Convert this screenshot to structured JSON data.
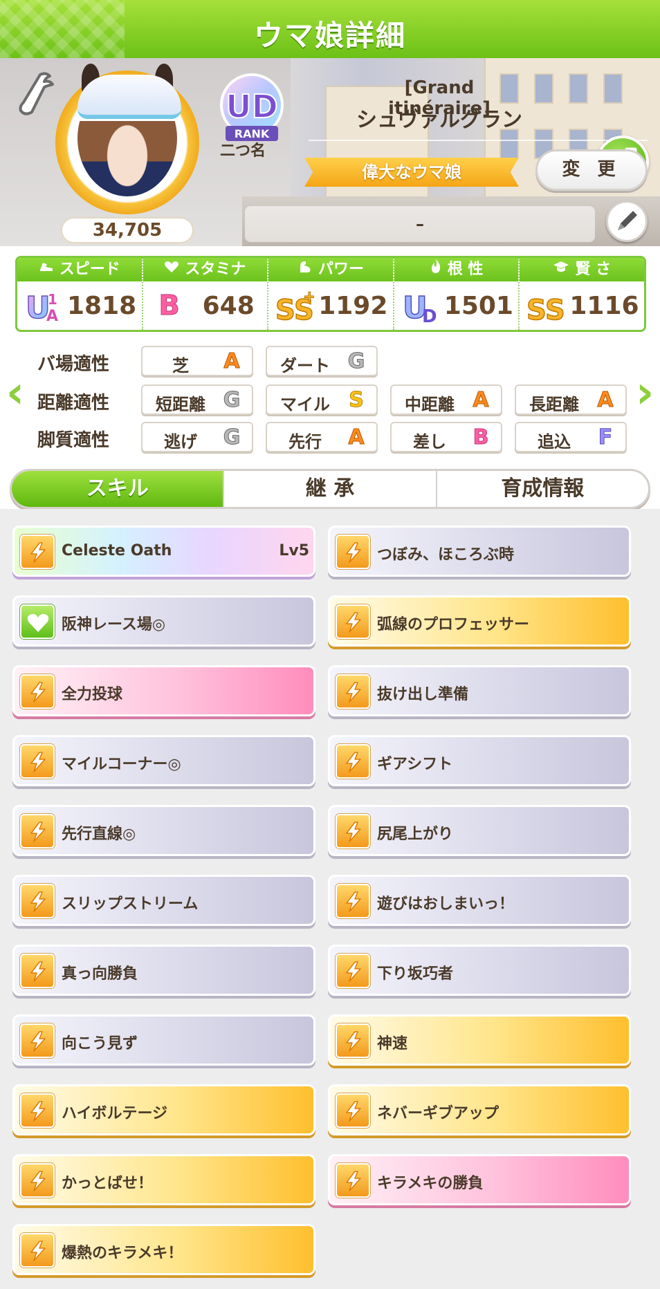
{
  "header": {
    "title": "ウマ娘詳細"
  },
  "profile": {
    "score": "34,705",
    "rank_badge_text": "RANK",
    "rank_badge_grade": "UD",
    "epithet": "二つ名",
    "nickname": "[Grand itinéraire]",
    "name": "シュヴァルグラン",
    "title_ribbon": "偉大なウマ娘",
    "change_label": "変 更",
    "comment": "–"
  },
  "stats": [
    {
      "label": "スピード",
      "icon": "shoe-icon",
      "grade": "UA1",
      "value": "1818"
    },
    {
      "label": "スタミナ",
      "icon": "heart-icon",
      "grade": "B",
      "value": "648"
    },
    {
      "label": "パワー",
      "icon": "arm-icon",
      "grade": "SS+",
      "value": "1192"
    },
    {
      "label": "根 性",
      "icon": "flame-icon",
      "grade": "UD",
      "value": "1501"
    },
    {
      "label": "賢 さ",
      "icon": "mortarboard-icon",
      "grade": "SS",
      "value": "1116"
    }
  ],
  "aptitude": {
    "track": {
      "label": "バ場適性",
      "items": [
        {
          "name": "芝",
          "grade": "A"
        },
        {
          "name": "ダート",
          "grade": "G"
        }
      ]
    },
    "distance": {
      "label": "距離適性",
      "items": [
        {
          "name": "短距離",
          "grade": "G"
        },
        {
          "name": "マイル",
          "grade": "S"
        },
        {
          "name": "中距離",
          "grade": "A"
        },
        {
          "name": "長距離",
          "grade": "A"
        }
      ]
    },
    "style": {
      "label": "脚質適性",
      "items": [
        {
          "name": "逃げ",
          "grade": "G"
        },
        {
          "name": "先行",
          "grade": "A"
        },
        {
          "name": "差し",
          "grade": "B"
        },
        {
          "name": "追込",
          "grade": "F"
        }
      ]
    }
  },
  "tabs": [
    "スキル",
    "継 承",
    "育成情報"
  ],
  "skills": [
    {
      "name": "Celeste Oath",
      "lv": "Lv5",
      "style": "rainbow",
      "icon": "speed-icon"
    },
    {
      "name": "つぼみ、ほころぶ時",
      "style": "normal",
      "icon": "speed-icon"
    },
    {
      "name": "阪神レース場◎",
      "style": "normal",
      "icon": "heart-icon"
    },
    {
      "name": "弧線のプロフェッサー",
      "style": "gold",
      "icon": "speed-icon"
    },
    {
      "name": "全力投球",
      "style": "pink",
      "icon": "speed-icon"
    },
    {
      "name": "抜け出し準備",
      "style": "normal",
      "icon": "speed-icon"
    },
    {
      "name": "マイルコーナー◎",
      "style": "normal",
      "icon": "speed-icon"
    },
    {
      "name": "ギアシフト",
      "style": "normal",
      "icon": "speed-icon"
    },
    {
      "name": "先行直線◎",
      "style": "normal",
      "icon": "speed-icon"
    },
    {
      "name": "尻尾上がり",
      "style": "normal",
      "icon": "speed-icon"
    },
    {
      "name": "スリップストリーム",
      "style": "normal",
      "icon": "speed-icon"
    },
    {
      "name": "遊びはおしまいっ！",
      "style": "normal",
      "icon": "speed-icon"
    },
    {
      "name": "真っ向勝負",
      "style": "normal",
      "icon": "speed-icon"
    },
    {
      "name": "下り坂巧者",
      "style": "normal",
      "icon": "speed-icon"
    },
    {
      "name": "向こう見ず",
      "style": "normal",
      "icon": "speed-icon"
    },
    {
      "name": "神速",
      "style": "gold",
      "icon": "speed-icon"
    },
    {
      "name": "ハイボルテージ",
      "style": "gold",
      "icon": "speed-icon"
    },
    {
      "name": "ネバーギブアップ",
      "style": "gold",
      "icon": "speed-icon"
    },
    {
      "name": "かっとばせ！",
      "style": "gold",
      "icon": "speed-icon"
    },
    {
      "name": "キラメキの勝負",
      "style": "pink",
      "icon": "speed-icon"
    },
    {
      "name": "爆熱のキラメキ！",
      "style": "gold",
      "icon": "speed-icon"
    }
  ],
  "colors": {
    "accent": "#6cc117",
    "gold": "#f4a516",
    "pink": "#ff8dbd"
  }
}
